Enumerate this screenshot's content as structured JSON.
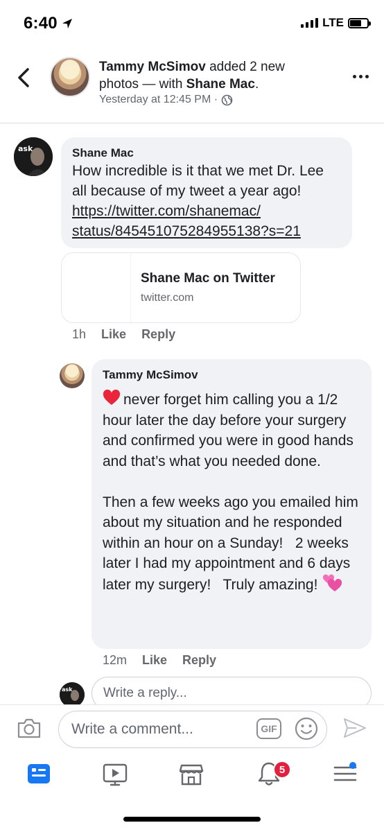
{
  "status_bar": {
    "time": "6:40",
    "network": "LTE"
  },
  "header": {
    "actor": "Tammy McSimov",
    "action": " added 2 new photos — with ",
    "tagged": "Shane Mac",
    "trailing": ".",
    "timestamp": "Yesterday at 12:45 PM ·"
  },
  "comments": [
    {
      "author": "Shane Mac",
      "text": "How incredible is it that we met Dr. Lee all because of my tweet a year ago! ",
      "link": "https://twitter.com/shanemac/status/845451075284955138?s=21",
      "link_line1": "https://twitter.com/shanemac/",
      "link_line2": "status/845451075284955138?s=21",
      "preview": {
        "title": "Shane Mac on Twitter",
        "domain": "twitter.com"
      },
      "time": "1h",
      "like_label": "Like",
      "reply_label": "Reply"
    },
    {
      "author": "Tammy McSimov",
      "text_part1": "never forget him calling you a 1/2 hour later the day before your surgery and confirmed you were in good hands and that’s what you needed done.\n\nThen a few weeks ago you emailed him about my situation and he responded within an hour on a Sunday!   2 weeks later I had my appointment and 6 days later my surgery!   Truly amazing!",
      "time": "12m",
      "like_label": "Like",
      "reply_label": "Reply"
    }
  ],
  "reply_box": {
    "placeholder": "Write a reply..."
  },
  "composer": {
    "placeholder": "Write a comment...",
    "gif_label": "GIF"
  },
  "nav": {
    "notifications_count": "5",
    "tabs": [
      "news-feed",
      "watch",
      "marketplace",
      "notifications",
      "menu"
    ]
  },
  "colors": {
    "accent": "#1877f2",
    "badge": "#e41e3f",
    "bubble": "#f0f2f5",
    "muted": "#606770"
  }
}
